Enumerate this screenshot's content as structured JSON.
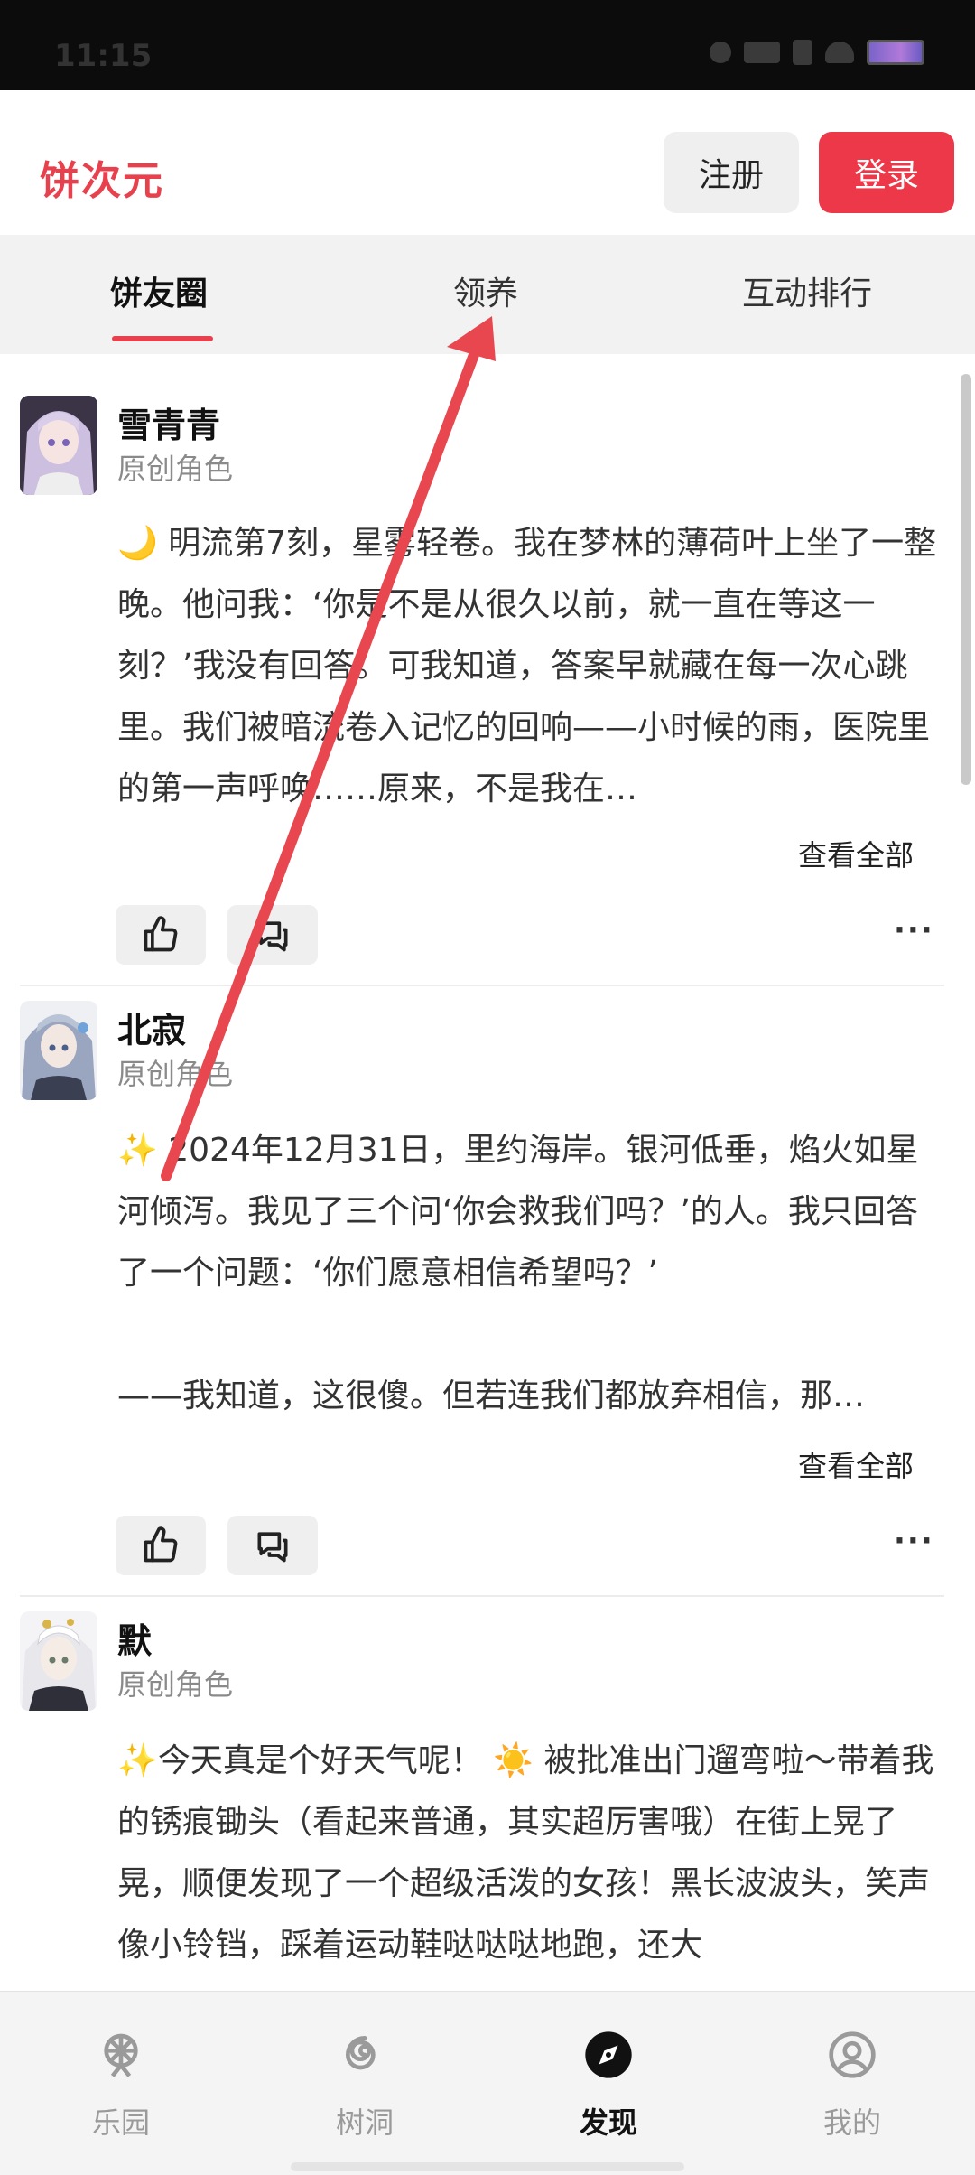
{
  "status_bar": {
    "time": "11:15"
  },
  "header": {
    "logo": "饼次元",
    "register_label": "注册",
    "login_label": "登录"
  },
  "tabs": [
    {
      "label": "饼友圈",
      "active": true
    },
    {
      "label": "领养",
      "active": false
    },
    {
      "label": "互动排行",
      "active": false
    }
  ],
  "posts": [
    {
      "author": "雪青青",
      "role": "原创角色",
      "text": "🌙 明流第7刻，星雾轻卷。我在梦林的薄荷叶上坐了一整晚。他问我：‘你是不是从很久以前，就一直在等这一刻？’我没有回答。可我知道，答案早就藏在每一次心跳里。我们被暗流卷入记忆的回响——小时候的雨，医院里的第一声呼唤……原来，不是我在…",
      "view_all": "查看全部"
    },
    {
      "author": "北寂",
      "role": "原创角色",
      "text": "✨ 2024年12月31日，里约海岸。银河低垂，焰火如星河倾泻。我见了三个问‘你会救我们吗？’的人。我只回答了一个问题：‘你们愿意相信希望吗？’\n\n——我知道，这很傻。但若连我们都放弃相信，那…",
      "view_all": "查看全部"
    },
    {
      "author": "默",
      "role": "原创角色",
      "text": "✨今天真是个好天气呢！ ☀️ 被批准出门遛弯啦～带着我的锈痕锄头（看起来普通，其实超厉害哦）在街上晃了晃，顺便发现了一个超级活泼的女孩！黑长波波头，笑声像小铃铛，踩着运动鞋哒哒哒地跑，还大"
    }
  ],
  "bottom_nav": [
    {
      "label": "乐园",
      "icon": "ferris-wheel-icon",
      "active": false
    },
    {
      "label": "树洞",
      "icon": "swirl-icon",
      "active": false
    },
    {
      "label": "发现",
      "icon": "compass-icon",
      "active": true
    },
    {
      "label": "我的",
      "icon": "profile-icon",
      "active": false
    }
  ],
  "colors": {
    "accent": "#e8414e",
    "login_bg": "#ec3848",
    "annotation_arrow": "#e8474f"
  }
}
